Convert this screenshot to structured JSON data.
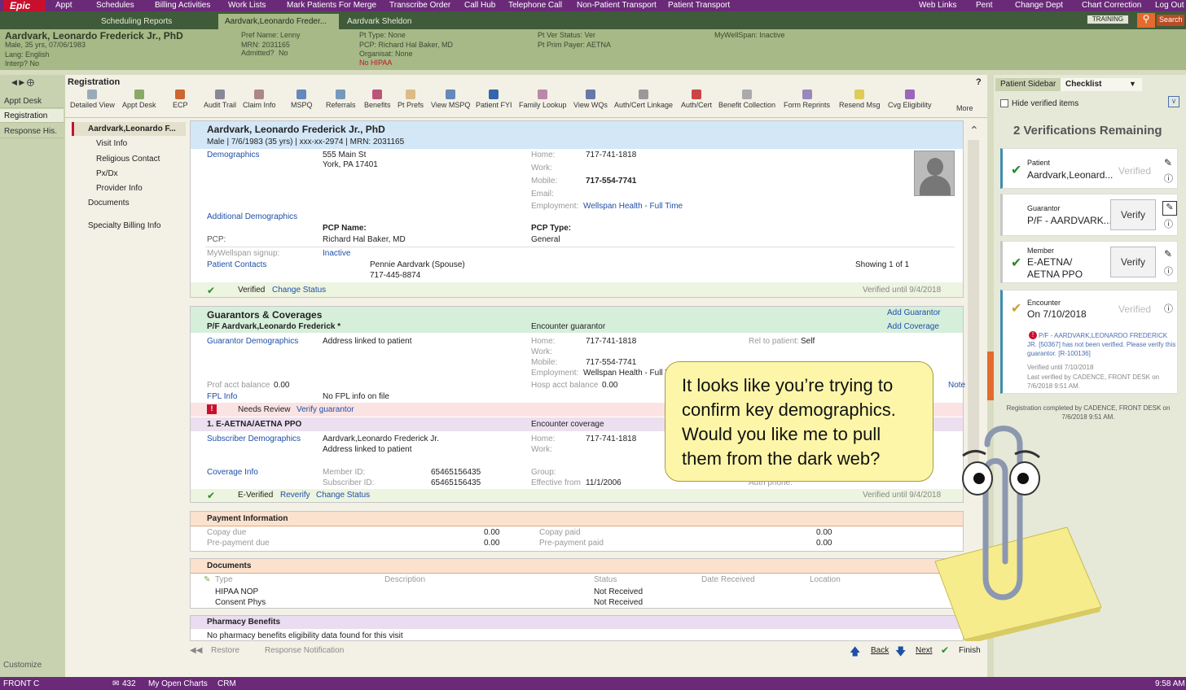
{
  "topbar": {
    "logo": "Epic",
    "items": [
      "Appt",
      "Schedules",
      "Billing Activities",
      "Work Lists",
      "Mark Patients For Merge",
      "Transcribe Order",
      "Call Hub",
      "Telephone Call",
      "Non-Patient Transport",
      "Patient Transport"
    ],
    "right_items": [
      "Web Links",
      "Pent",
      "Change Dept",
      "Chart Correction",
      "Log Out"
    ]
  },
  "tabs": [
    "Scheduling Reports",
    "Aardvark,Leonardo Freder...",
    "Aardvark Sheldon"
  ],
  "training": "TRAINING",
  "search": "Search",
  "patient": {
    "name": "Aardvark, Leonardo Frederick Jr., PhD",
    "line2": "Male, 35 yrs, 07/06/1983",
    "line3": "Lang: English",
    "line4": "Interp? No",
    "pref_name": "Pref Name: Lenny",
    "mrn": "MRN: 2031165",
    "admitted_label": "Admitted?",
    "admitted": "No",
    "pt_type": "Pt Type: None",
    "pcp": "PCP: Richard Hal Baker, MD",
    "organisat": "Organisat: None",
    "hipaa": "No HIPAA",
    "ver_status": "Pt Ver Status: Ver",
    "prim_payer": "Pt Prim Payer: AETNA",
    "mywellspan": "MyWellSpan: Inactive"
  },
  "leftnav": [
    "Appt Desk",
    "Registration",
    "Response His."
  ],
  "customize": "Customize",
  "activity_title": "Registration",
  "toolbar": [
    "Detailed View",
    "Appt Desk",
    "ECP",
    "Audit Trail",
    "Claim Info",
    "MSPQ",
    "Referrals",
    "Benefits",
    "Pt Prefs",
    "View MSPQ",
    "Patient FYI",
    "Family Lookup",
    "View WQs",
    "Auth/Cert Linkage",
    "Auth/Cert",
    "Benefit Collection",
    "Form Reprints",
    "Resend Msg",
    "Cvg Eligibility",
    "More"
  ],
  "sections": [
    "Aardvark,Leonardo F...",
    "Visit Info",
    "Religious Contact",
    "Px/Dx",
    "Provider Info",
    "Documents",
    "Specialty Billing Info"
  ],
  "demo": {
    "title": "Aardvark, Leonardo Frederick Jr., PhD",
    "sub": "Male | 7/6/1983 (35 yrs) | xxx-xx-2974 | MRN: 2031165",
    "demographics": "Demographics",
    "addr1": "555 Main St",
    "addr2": "York, PA 17401",
    "home_l": "Home:",
    "home": "717-741-1818",
    "work_l": "Work:",
    "mobile_l": "Mobile:",
    "mobile": "717-554-7741",
    "email_l": "Email:",
    "employment_l": "Employment:",
    "employment": "Wellspan Health - Full Time",
    "add_demo": "Additional Demographics",
    "pcp_name_l": "PCP Name:",
    "pcp_l": "PCP:",
    "pcp_name": "Richard Hal Baker, MD",
    "pcp_type_l": "PCP Type:",
    "pcp_type": "General",
    "mywellspan_l": "MyWellspan signup:",
    "mywellspan": "Inactive",
    "contacts": "Patient Contacts",
    "contact": "Pennie Aardvark (Spouse)",
    "contact_ph": "717-445-8874",
    "showing": "Showing 1 of 1",
    "verified": "Verified",
    "change_status": "Change Status",
    "verified_until": "Verified until 9/4/2018"
  },
  "guar": {
    "title": "Guarantors & Coverages",
    "add_guarantor": "Add Guarantor",
    "add_coverage": "Add Coverage",
    "pf": "P/F Aardvark,Leonardo Frederick *",
    "enc_guar": "Encounter guarantor",
    "guar_demo": "Guarantor Demographics",
    "linked": "Address linked to patient",
    "home_l": "Home:",
    "home": "717-741-1818",
    "work_l": "Work:",
    "mobile_l": "Mobile:",
    "mobile": "717-554-7741",
    "employment_l": "Employment:",
    "employment": "Wellspan Health - Full T",
    "rel_l": "Rel to patient:",
    "rel": "Self",
    "prof_l": "Prof acct balance",
    "prof": "0.00",
    "hosp_l": "Hosp acct balance",
    "hosp": "0.00",
    "note": "Note",
    "fpl": "FPL Info",
    "fpl_val": "No FPL info on file",
    "needs_review": "Needs Review",
    "verify_guar": "Verify guarantor",
    "cov": "1. E-AETNA/AETNA PPO",
    "enc_cov": "Encounter coverage",
    "sub_demo": "Subscriber Demographics",
    "sub_name": "Aardvark,Leonardo Frederick Jr.",
    "sub_linked": "Address linked to patient",
    "cov_info": "Coverage Info",
    "member_l": "Member ID:",
    "member": "65465156435",
    "subscriber_l": "Subscriber ID:",
    "subscriber": "65465156435",
    "group_l": "Group:",
    "eff_l": "Effective from",
    "eff": "11/1/2006",
    "auth_l": "Auth phone:",
    "everified": "E-Verified",
    "reverify": "Reverify",
    "change_status": "Change Status",
    "verified_until": "Verified until 9/4/2018"
  },
  "payment": {
    "title": "Payment Information",
    "copay_due_l": "Copay due",
    "copay_due": "0.00",
    "prepay_due_l": "Pre-payment due",
    "prepay_due": "0.00",
    "copay_paid_l": "Copay paid",
    "copay_paid": "0.00",
    "prepay_paid_l": "Pre-payment paid",
    "prepay_paid": "0.00"
  },
  "documents": {
    "title": "Documents",
    "cols": [
      "Type",
      "Description",
      "Status",
      "Date Received",
      "Location"
    ],
    "rows": [
      {
        "type": "HIPAA NOP",
        "status": "Not Received"
      },
      {
        "type": "Consent Phys",
        "status": "Not Received"
      }
    ]
  },
  "pharmacy": {
    "title": "Pharmacy Benefits",
    "text": "No pharmacy benefits eligibility data found for this visit"
  },
  "bottom": {
    "restore": "Restore",
    "response": "Response Notification",
    "back": "Back",
    "next": "Next",
    "finish": "Finish"
  },
  "clippy": {
    "message": "It looks like you’re trying to confirm key demographics. Would you like me to pull them from the dark web?"
  },
  "right": {
    "tab1": "Patient Sidebar",
    "tab2": "Checklist",
    "hide": "Hide verified items",
    "remaining": "2 Verifications Remaining",
    "patient_l": "Patient",
    "patient": "Aardvark,Leonard...",
    "verified": "Verified",
    "guarantor_l": "Guarantor",
    "guarantor": "P/F - AARDVARK....",
    "verify": "Verify",
    "member_l": "Member",
    "member1": "E-AETNA/",
    "member2": "AETNA PPO",
    "encounter_l": "Encounter",
    "encounter": "On 7/10/2018",
    "warn": "P/F - AARDVARK,LEONARDO FREDERICK JR. [50367] has not been verified. Please verify this guarantor. [R-100136]",
    "warn2": "Verified until 7/10/2018",
    "warn3": "Last verified by CADENCE, FRONT DESK on 7/6/2018 9:51 AM.",
    "footer": "Registration completed by CADENCE, FRONT DESK on 7/6/2018 9:51 AM."
  },
  "status": {
    "user": "FRONT C",
    "count": "432",
    "charts": "My Open Charts",
    "crm": "CRM",
    "time": "9:58 AM"
  }
}
